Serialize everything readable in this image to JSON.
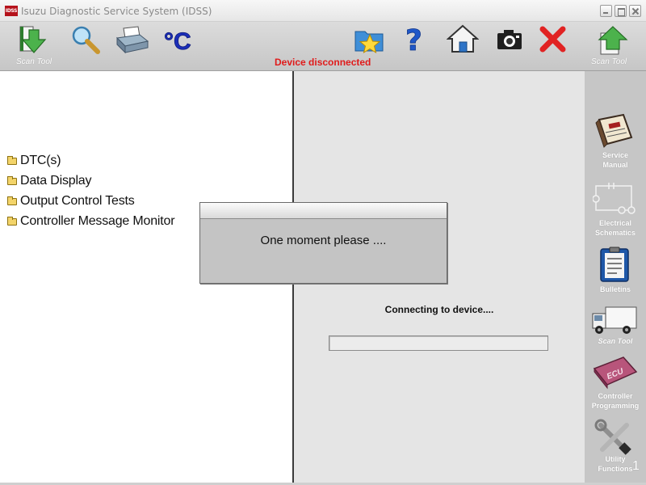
{
  "window": {
    "title": "Isuzu Diagnostic Service System (IDSS)",
    "app_icon_text": "IDSS"
  },
  "toolbar": {
    "left_label": "Scan Tool",
    "right_label": "Scan Tool",
    "status": "Device disconnected",
    "status_color": "#e01b1b",
    "temp_unit": "°C",
    "icons": [
      "back-arrow-icon",
      "search-icon",
      "printer-icon",
      "celsius-icon",
      "folder-star-icon",
      "help-icon",
      "home-icon",
      "camera-icon",
      "close-icon",
      "forward-arrow-icon"
    ]
  },
  "tree": {
    "items": [
      {
        "label": "DTC(s)"
      },
      {
        "label": "Data Display"
      },
      {
        "label": "Output Control Tests"
      },
      {
        "label": "Controller Message Monitor"
      }
    ]
  },
  "dialog": {
    "message": "One moment please ...."
  },
  "main": {
    "connecting": "Connecting to device....",
    "progress": 0
  },
  "sidebar": {
    "items": [
      {
        "label_1": "Service",
        "label_2": "Manual",
        "icon": "service-manual-icon"
      },
      {
        "label_1": "Electrical",
        "label_2": "Schematics",
        "icon": "schematic-icon"
      },
      {
        "label_1": "Bulletins",
        "label_2": "",
        "icon": "bulletin-icon"
      },
      {
        "label_1": "Scan Tool",
        "label_2": "",
        "icon": "truck-icon"
      },
      {
        "label_1": "Controller",
        "label_2": "Programming",
        "icon": "ecu-icon"
      },
      {
        "label_1": "Utility",
        "label_2": "Functions",
        "icon": "wrench-icon"
      }
    ]
  },
  "page_number": "1"
}
